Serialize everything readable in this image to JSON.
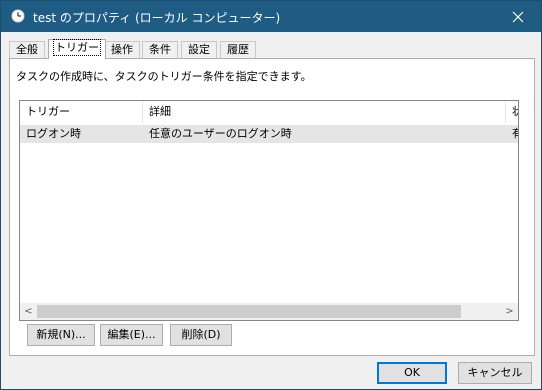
{
  "window": {
    "title": "test のプロパティ (ローカル コンピューター)"
  },
  "tabs": [
    {
      "label": "全般"
    },
    {
      "label": "トリガー"
    },
    {
      "label": "操作"
    },
    {
      "label": "条件"
    },
    {
      "label": "設定"
    },
    {
      "label": "履歴"
    }
  ],
  "active_tab_index": 1,
  "description": "タスクの作成時に、タスクのトリガー条件を指定できます。",
  "table": {
    "columns": [
      "トリガー",
      "詳細",
      "状"
    ],
    "rows": [
      [
        "ログオン時",
        "任意のユーザーのログオン時",
        "有"
      ]
    ]
  },
  "scrollbar": {
    "left_arrow": "<",
    "right_arrow": ">"
  },
  "buttons": {
    "new": "新規(N)...",
    "edit": "編集(E)...",
    "delete": "削除(D)",
    "ok": "OK",
    "cancel": "キャンセル"
  },
  "colors": {
    "titlebar": "#1f5c84",
    "accent": "#0078d7",
    "selected_row": "#e5e5e5"
  }
}
